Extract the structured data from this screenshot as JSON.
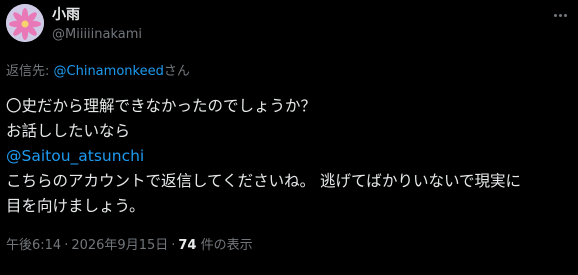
{
  "colors": {
    "background": "#000000",
    "text_primary": "#e7e9ea",
    "text_secondary": "#71767b",
    "link": "#1d9bf0"
  },
  "author": {
    "display_name": "小雨",
    "handle": "@Miiiiinakami",
    "avatar_icon": "lotus-flower-avatar"
  },
  "reply": {
    "prefix": "返信先: ",
    "mention": "@Chinamonkeed",
    "suffix": "さん"
  },
  "body": {
    "line1": "〇史だから理解できなかったのでしょうか？",
    "line2": "お話ししたいなら",
    "line3_link": "@Saitou_atsunchi",
    "line4": "こちらのアカウントで返信してくださいね。 逃げてばかりいないで現実に",
    "line5": "目を向けましょう。"
  },
  "meta": {
    "time": "午後6:14",
    "date": "2026年9月15日",
    "separator": "·",
    "views_count": "74",
    "views_label": " 件の表示"
  },
  "more_button_icon": "more-horizontal-icon"
}
